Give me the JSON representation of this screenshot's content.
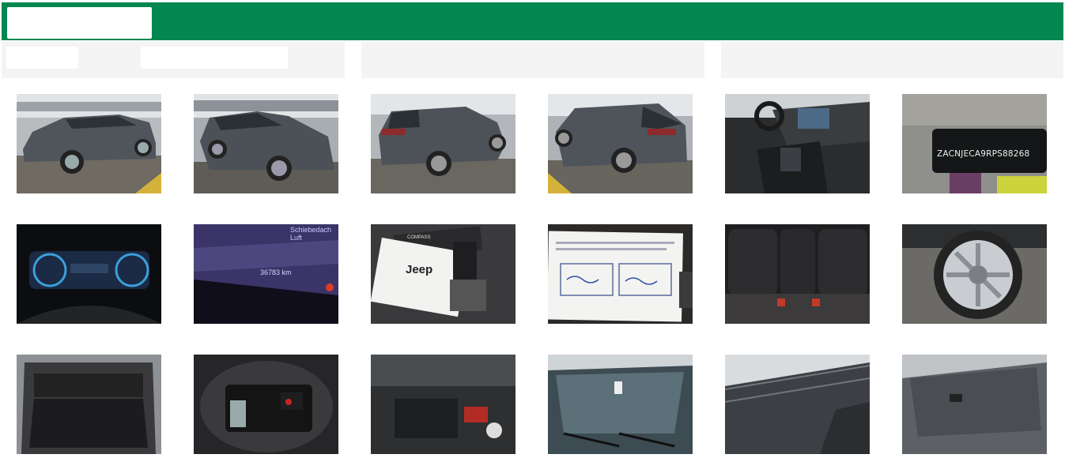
{
  "header": {
    "logo_icon": "logo-placeholder",
    "brand_color": "#01874f"
  },
  "gallery": {
    "photos": [
      {
        "name": "front-left-view",
        "caption": ""
      },
      {
        "name": "front-right-view",
        "caption": ""
      },
      {
        "name": "rear-left-view",
        "caption": ""
      },
      {
        "name": "rear-right-view",
        "caption": ""
      },
      {
        "name": "dashboard-interior",
        "caption": ""
      },
      {
        "name": "vin-plate",
        "caption": "ZACNJECA9RPS88268"
      },
      {
        "name": "instrument-cluster",
        "caption": ""
      },
      {
        "name": "odometer-display",
        "caption": "36783 km",
        "top_text": "Schiebedach Luft"
      },
      {
        "name": "owner-manuals",
        "caption": "Jeep",
        "top_text": "COMPASS"
      },
      {
        "name": "service-document",
        "caption": ""
      },
      {
        "name": "rear-seats",
        "caption": ""
      },
      {
        "name": "wheel-rim",
        "caption": ""
      },
      {
        "name": "trunk-open",
        "caption": ""
      },
      {
        "name": "spare-tire-kit",
        "caption": ""
      },
      {
        "name": "engine-bay",
        "caption": ""
      },
      {
        "name": "windshield",
        "caption": ""
      },
      {
        "name": "roof-view",
        "caption": ""
      },
      {
        "name": "sunroof-view",
        "caption": ""
      }
    ]
  }
}
